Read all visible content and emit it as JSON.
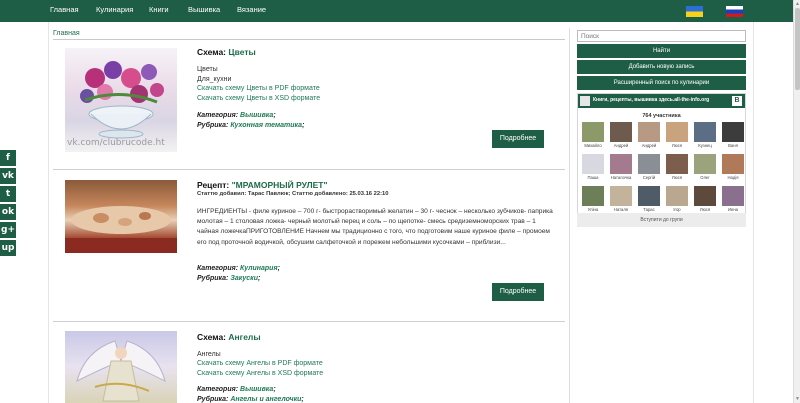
{
  "nav": {
    "items": [
      "Главная",
      "Кулинария",
      "Книги",
      "Вышивка",
      "Вязание"
    ]
  },
  "breadcrumb": "Главная",
  "posts": [
    {
      "type_label": "Схема:",
      "title": "Цветы",
      "lines": [
        "Цветы",
        "Для_кухни"
      ],
      "links": [
        "Скачать схему Цветы в PDF формате",
        "Скачать схему Цветы в XSD формате"
      ],
      "category_label": "Категория:",
      "category": "Вышивка",
      "rubric_label": "Рубрика:",
      "rubric": "Кухонная тематика",
      "more": "Подробнее",
      "thumb_caption": "vk.com/clubrucode.ht"
    },
    {
      "type_label": "Рецепт:",
      "title": "\"МРАМОРНЫЙ РУЛЕТ\"",
      "byline": "Статтю добавил: Тарас Павлюк; Статтю добавлено: 25.03.16 22:10",
      "body": "ИНГРЕДИЕНТЫ - филе куриное – 700 г- быстрорастворимый желатин – 30 г- чеснок – несколько зубчиков- паприка молотая – 1 столовая ложка- черный молотый перец и соль – по щепотке- смесь средиземноморских трав – 1 чайная ложечкаПРИГОТОВЛЕНИЕ Начнем мы традиционно с того, что подготовим наше куриное филе – промоем его под проточной водичкой, обсушим салфеточкой и порежем небольшими кусочками – приблизи...",
      "category_label": "Категория:",
      "category": "Кулинария",
      "rubric_label": "Рубрика:",
      "rubric": "Закуски",
      "more": "Подробнее"
    },
    {
      "type_label": "Схема:",
      "title": "Ангелы",
      "lines": [
        "Ангелы"
      ],
      "links": [
        "Скачать схему Ангелы в PDF формате",
        "Скачать схему Ангелы в XSD формате"
      ],
      "category_label": "Категория:",
      "category": "Вышивка",
      "rubric_label": "Рубрика:",
      "rubric": "Ангелы и ангелочки"
    }
  ],
  "sidebar": {
    "search_placeholder": "Поиск",
    "find_button": "Найти",
    "add_button": "Добавить новую запись",
    "advanced_button": "Расширенный поиск по кулинарии",
    "vk": {
      "title": "Книги, рецепты, вышивка здесь.all-the-info.org",
      "badge": "В",
      "count": "764 участника",
      "members": [
        "Михайло",
        "Андрей",
        "Андрей",
        "Люся",
        "Кузнец",
        "Ваня",
        "Паша",
        "Наталочка",
        "Сергій",
        "Люся",
        "Олег",
        "Надія",
        "Уліна",
        "Наталя",
        "Тарас",
        "Ігор",
        "Люся",
        "Инна"
      ],
      "join": "Вступити до групи"
    }
  },
  "social": [
    "f",
    "vk",
    "t",
    "ok",
    "g+",
    "up"
  ],
  "colors": {
    "brand": "#1e5e47",
    "link": "#1e7a55"
  }
}
